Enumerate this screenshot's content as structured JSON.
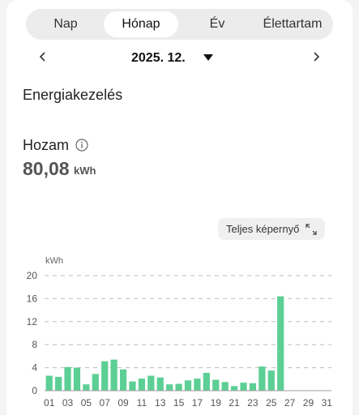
{
  "tabs": [
    {
      "label": "Nap",
      "active": false
    },
    {
      "label": "Hónap",
      "active": true
    },
    {
      "label": "Év",
      "active": false
    },
    {
      "label": "Élettartam",
      "active": false
    }
  ],
  "date_nav": {
    "prev_icon": "chevron-left-icon",
    "label": "2025. 12.",
    "dropdown_icon": "caret-down-icon",
    "next_icon": "chevron-right-icon"
  },
  "section_title": "Energiakezelés",
  "yield": {
    "label": "Hozam",
    "info_icon": "info-icon",
    "value": "80,08",
    "unit": "kWh"
  },
  "fullscreen_button": {
    "label": "Teljes képernyő",
    "icon": "expand-icon"
  },
  "colors": {
    "bar": "#5ccf94",
    "active_tab_bg": "#ffffff",
    "tabs_bg": "#ececec"
  },
  "chart_data": {
    "type": "bar",
    "ylabel": "kWh",
    "ylim": [
      0,
      20
    ],
    "yticks": [
      "0",
      "4",
      "8",
      "12",
      "16",
      "20"
    ],
    "grid": "dashed horizontal",
    "categories": [
      "01",
      "02",
      "03",
      "04",
      "05",
      "06",
      "07",
      "08",
      "09",
      "10",
      "11",
      "12",
      "13",
      "14",
      "15",
      "16",
      "17",
      "18",
      "19",
      "20",
      "21",
      "22",
      "23",
      "24",
      "25",
      "26",
      "27",
      "28",
      "29",
      "30",
      "31"
    ],
    "xtick_labels": [
      "01",
      "03",
      "05",
      "07",
      "09",
      "11",
      "13",
      "15",
      "17",
      "19",
      "21",
      "23",
      "25",
      "27",
      "29",
      "31"
    ],
    "values": [
      2.6,
      2.4,
      4.1,
      4.0,
      1.1,
      2.9,
      5.1,
      5.4,
      3.7,
      1.6,
      2.1,
      2.6,
      2.3,
      1.1,
      1.2,
      1.8,
      2.1,
      3.1,
      1.9,
      1.5,
      0.8,
      1.4,
      1.3,
      4.2,
      3.5,
      16.4,
      0,
      0,
      0,
      0,
      0
    ]
  }
}
